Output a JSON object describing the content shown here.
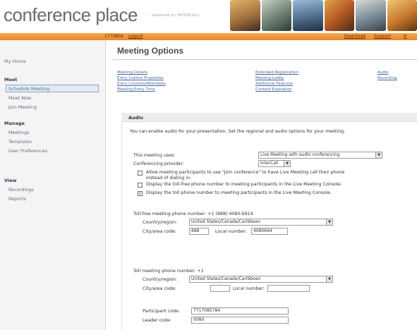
{
  "header": {
    "logo_text": "conference place",
    "powered_by": "powered by INTERCALL"
  },
  "topbar": {
    "account": "1770804",
    "logout": "Logout",
    "download": "Download",
    "support": "Support",
    "help": "H"
  },
  "sidebar": {
    "my_home": "My Home",
    "meet_heading": "Meet",
    "meet_items": [
      "Schedule Meeting",
      "Meet Now",
      "Join Meeting"
    ],
    "manage_heading": "Manage",
    "manage_items": [
      "Meetings",
      "Templates",
      "User Preferences"
    ],
    "view_heading": "View",
    "view_items": [
      "Recordings",
      "Reports"
    ]
  },
  "page": {
    "title": "Meeting Options"
  },
  "options_nav": {
    "col1": [
      "Meeting Details",
      "Entry Control Properties",
      "Entry Controls/Attendees",
      "Meeting Entry Time"
    ],
    "col2": [
      "Extended Registration",
      "Meeting Lobby",
      "Additional Features",
      "Content Expiration"
    ],
    "col3": [
      "Audio",
      "Recording"
    ]
  },
  "audio": {
    "heading": "Audio",
    "intro": "You can enable audio for your presentation. Set the regional and audio options for your meeting.",
    "meeting_uses_label": "This meeting uses:",
    "meeting_uses_value": "Live Meeting with audio conferencing",
    "provider_label": "Conferencing provider:",
    "provider_value": "InterCall",
    "checkbox1_line1": "Allow meeting participants to use \"Join conference\" to have Live Meeting call their phone",
    "checkbox1_line2": "instead of dialing in.",
    "checkbox2": "Display the toll-free phone number to meeting participants in the Live Meeting Console.",
    "checkbox3": "Display the toll phone number to meeting participants in the Live Meeting Console.",
    "checkbox_states": [
      false,
      false,
      true
    ],
    "tollfree_heading": "Toll-free meeting phone number: +1 (888) 4080-6914",
    "country_label": "Country/region:",
    "country_value": "United States/Canada/Caribbean",
    "city_label": "City/area code:",
    "tollfree_city_value": "888",
    "local_label": "Local number:",
    "tollfree_local_value": "4080694",
    "toll_heading": "Toll meeting phone number: +1",
    "toll_country_value": "United States/Canada/Caribbean",
    "toll_city_value": "",
    "toll_local_value": "",
    "participant_code_label": "Participant code:",
    "participant_code_value": "7717085784",
    "leader_code_label": "Leader code:",
    "leader_code_value": "0080"
  },
  "colors": {
    "orange_bar": "#e9862a",
    "link": "#4a66a0"
  }
}
